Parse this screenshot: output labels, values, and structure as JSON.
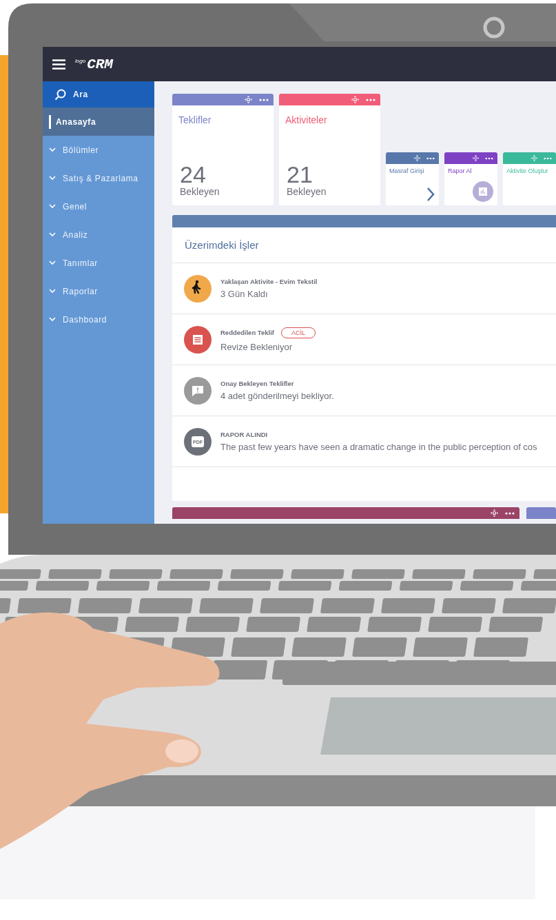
{
  "app": {
    "logo_small": "logo",
    "logo_main": "CRM"
  },
  "sidebar": {
    "items": [
      {
        "kind": "search",
        "label": "Ara",
        "selected": false
      },
      {
        "kind": "page",
        "label": "Anasayfa",
        "selected": true
      },
      {
        "kind": "group",
        "label": "Bölümler",
        "selected": false
      },
      {
        "kind": "group",
        "label": "Satış & Pazarlama",
        "selected": false
      },
      {
        "kind": "group",
        "label": "Genel",
        "selected": false
      },
      {
        "kind": "group",
        "label": "Analiz",
        "selected": false
      },
      {
        "kind": "group",
        "label": "Tanımlar",
        "selected": false
      },
      {
        "kind": "group",
        "label": "Raporlar",
        "selected": false
      },
      {
        "kind": "group",
        "label": "Dashboard",
        "selected": false
      }
    ]
  },
  "stat_cards": [
    {
      "title": "Teklifler",
      "value": "24",
      "caption": "Bekleyen",
      "color": "#7b84c8"
    },
    {
      "title": "Aktiviteler",
      "value": "21",
      "caption": "Bekleyen",
      "color": "#f15c78"
    }
  ],
  "shortcut_cards": [
    {
      "title": "Masraf Girişi",
      "kind": "arrow",
      "color": "#5878ab"
    },
    {
      "title": "Rapor Al",
      "kind": "report",
      "color": "#7f41c4"
    },
    {
      "title": "Aktivite Oluştur",
      "kind": "plain",
      "color": "#3bb99b"
    }
  ],
  "tasks": {
    "title": "Üzerimdeki İşler",
    "items": [
      {
        "kind": "walk",
        "color": "#f0a84a",
        "title": "Yaklaşan Aktivite - Evim Tekstil",
        "subtitle": "3 Gün Kaldı"
      },
      {
        "kind": "document",
        "color": "#d9534f",
        "title": "Reddedilen Teklif",
        "badge": "ACİL",
        "subtitle": "Revize Bekleniyor"
      },
      {
        "kind": "message",
        "color": "#9a9a9a",
        "title": "Onay Bekleyen Teklifler",
        "subtitle": "4 adet gönderilmeyi bekliyor."
      },
      {
        "kind": "pdf",
        "color": "#6c7078",
        "icon_label": "PDF",
        "title": "RAPOR ALINDI",
        "subtitle": "The past few years have seen a dramatic change in the public perception of cos"
      }
    ]
  },
  "bottom_widgets": [
    {
      "color": "#9a4467",
      "actions": true
    },
    {
      "color": "#7b84c8",
      "actions": false
    }
  ]
}
